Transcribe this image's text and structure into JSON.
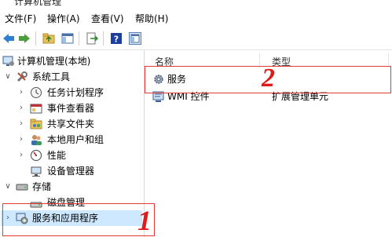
{
  "window": {
    "title": "计算机管理"
  },
  "menu": [
    "文件(F)",
    "操作(A)",
    "查看(V)",
    "帮助(H)"
  ],
  "toolbar": {
    "buttons": [
      "back-icon",
      "forward-icon",
      "up-folder-icon",
      "show-hide-tree-icon",
      "export-list-icon",
      "help-icon",
      "properties-view-icon"
    ]
  },
  "tree": {
    "root": "计算机管理(本地)",
    "system_tools": "系统工具",
    "task_scheduler": "任务计划程序",
    "event_viewer": "事件查看器",
    "shared_folders": "共享文件夹",
    "local_users": "本地用户和组",
    "performance": "性能",
    "device_manager": "设备管理器",
    "storage": "存储",
    "disk_management": "磁盘管理",
    "services_apps": "服务和应用程序"
  },
  "list": {
    "columns": [
      "名称",
      "类型"
    ],
    "rows": [
      {
        "name": "服务",
        "type": ""
      },
      {
        "name": "WMI 控件",
        "type": "扩展管理单元"
      }
    ]
  },
  "annotations": {
    "label_1": "1",
    "label_2": "2"
  },
  "colors": {
    "annotation": "#e53935",
    "selected_bg": "#cde8ff"
  }
}
